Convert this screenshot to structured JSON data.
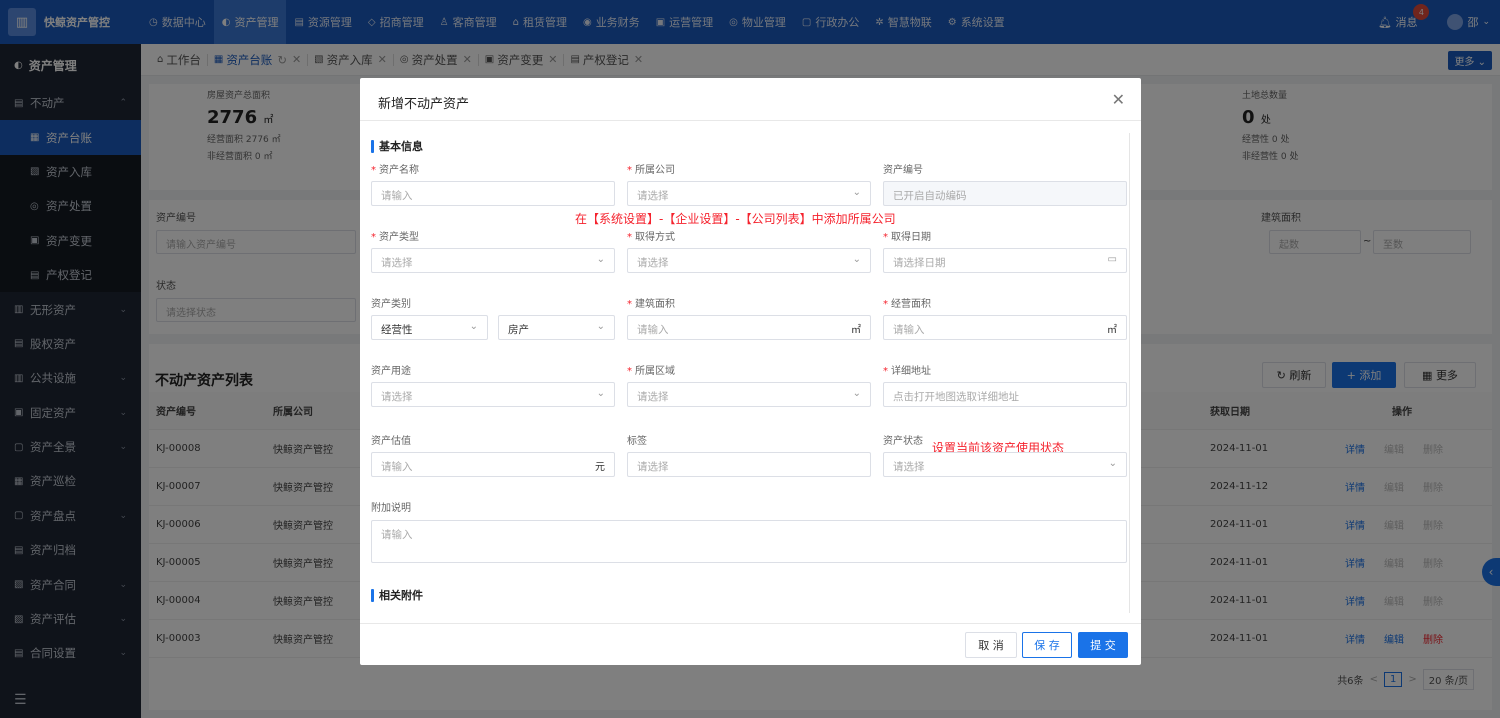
{
  "app": {
    "logo_text": "快鲸资产管控"
  },
  "topnav": [
    {
      "icon": "◷",
      "label": "数据中心"
    },
    {
      "icon": "◐",
      "label": "资产管理",
      "active": true
    },
    {
      "icon": "▤",
      "label": "资源管理"
    },
    {
      "icon": "◇",
      "label": "招商管理"
    },
    {
      "icon": "♙",
      "label": "客商管理"
    },
    {
      "icon": "⌂",
      "label": "租赁管理"
    },
    {
      "icon": "◉",
      "label": "业务财务"
    },
    {
      "icon": "▣",
      "label": "运营管理"
    },
    {
      "icon": "◎",
      "label": "物业管理"
    },
    {
      "icon": "▢",
      "label": "行政办公"
    },
    {
      "icon": "✲",
      "label": "智慧物联"
    },
    {
      "icon": "⚙",
      "label": "系统设置"
    }
  ],
  "header_right": {
    "message_label": "消息",
    "badge": "4",
    "user": "邵"
  },
  "sidebar": {
    "title": "资产管理",
    "items": [
      {
        "label": "不动产",
        "icon": "▤",
        "arrow": "⌃"
      },
      {
        "label": "资产台账",
        "sub": true,
        "active": true,
        "icon": "▦"
      },
      {
        "label": "资产入库",
        "sub": true,
        "icon": "▧"
      },
      {
        "label": "资产处置",
        "sub": true,
        "icon": "◎"
      },
      {
        "label": "资产变更",
        "sub": true,
        "icon": "▣"
      },
      {
        "label": "产权登记",
        "sub": true,
        "icon": "▤"
      },
      {
        "label": "无形资产",
        "icon": "▥",
        "arrow": "⌄"
      },
      {
        "label": "股权资产",
        "icon": "▤"
      },
      {
        "label": "公共设施",
        "icon": "▥",
        "arrow": "⌄"
      },
      {
        "label": "固定资产",
        "icon": "▣",
        "arrow": "⌄"
      },
      {
        "label": "资产全景",
        "icon": "▢",
        "arrow": "⌄"
      },
      {
        "label": "资产巡检",
        "icon": "▦"
      },
      {
        "label": "资产盘点",
        "icon": "▢",
        "arrow": "⌄"
      },
      {
        "label": "资产归档",
        "icon": "▤"
      },
      {
        "label": "资产合同",
        "icon": "▧",
        "arrow": "⌄"
      },
      {
        "label": "资产评估",
        "icon": "▨",
        "arrow": "⌄"
      },
      {
        "label": "合同设置",
        "icon": "▤",
        "arrow": "⌄"
      }
    ],
    "collapse_icon": "☰"
  },
  "tabs": [
    {
      "label": "工作台",
      "icon": "⌂",
      "closable": false
    },
    {
      "label": "资产台账",
      "icon": "▦",
      "active": true,
      "closable": true,
      "refresh": "↻"
    },
    {
      "label": "资产入库",
      "icon": "▧",
      "closable": true
    },
    {
      "label": "资产处置",
      "icon": "◎",
      "closable": true
    },
    {
      "label": "资产变更",
      "icon": "▣",
      "closable": true
    },
    {
      "label": "产权登记",
      "icon": "▤",
      "closable": true
    }
  ],
  "tabs_more": "更多 ⌄",
  "kpi_left": {
    "label": "房屋资产总面积",
    "value": "2776",
    "unit": "㎡",
    "sub1": "经营面积 2776 ㎡",
    "sub2": "非经营面积 0 ㎡"
  },
  "kpi_right": {
    "label": "土地总数量",
    "value": "0",
    "unit": "处",
    "sub1": "经营性 0 处",
    "sub2": "非经营性 0 处"
  },
  "filters": {
    "asset_no_label": "资产编号",
    "asset_no_ph": "请输入资产编号",
    "status_label": "状态",
    "status_ph": "请选择状态",
    "area_label": "建筑面积",
    "area_from": "起数",
    "area_sep": "~",
    "area_to": "至数"
  },
  "list": {
    "title": "不动产资产列表",
    "refresh": "刷新",
    "add": "+ 添加",
    "more": "更多",
    "col_no": "资产编号",
    "col_company": "所属公司",
    "col_date": "获取日期",
    "col_ops": "操作",
    "rows": [
      {
        "no": "KJ-00008",
        "company": "快鲸资产管控",
        "date": "2024-11-01"
      },
      {
        "no": "KJ-00007",
        "company": "快鲸资产管控",
        "date": "2024-11-12"
      },
      {
        "no": "KJ-00006",
        "company": "快鲸资产管控",
        "date": "2024-11-01"
      },
      {
        "no": "KJ-00005",
        "company": "快鲸资产管控",
        "date": "2024-11-01"
      },
      {
        "no": "KJ-00004",
        "company": "快鲸资产管控",
        "date": "2024-11-01"
      },
      {
        "no": "KJ-00003",
        "company": "快鲸资产管控",
        "date": "2024-11-01"
      }
    ],
    "op_detail": "详情",
    "op_edit": "编辑",
    "op_delete": "删除",
    "total": "共6条",
    "page": "1",
    "page_size": "20 条/页"
  },
  "modal": {
    "title": "新增不动产资产",
    "section_basic": "基本信息",
    "section_attach": "相关附件",
    "fields": {
      "name_label": "资产名称",
      "name_ph": "请输入",
      "company_label": "所属公司",
      "company_ph": "请选择",
      "code_label": "资产编号",
      "code_ph": "已开启自动编码",
      "type_label": "资产类型",
      "type_ph": "请选择",
      "acquire_label": "取得方式",
      "acquire_ph": "请选择",
      "date_label": "取得日期",
      "date_ph": "请选择日期",
      "category_label": "资产类别",
      "category_v1": "经营性",
      "category_v2": "房产",
      "build_area_label": "建筑面积",
      "build_area_ph": "请输入",
      "area_unit": "㎡",
      "op_area_label": "经营面积",
      "op_area_ph": "请输入",
      "usage_label": "资产用途",
      "usage_ph": "请选择",
      "region_label": "所属区域",
      "region_ph": "请选择",
      "address_label": "详细地址",
      "address_ph": "点击打开地图选取详细地址",
      "value_label": "资产估值",
      "value_ph": "请输入",
      "value_unit": "元",
      "tag_label": "标签",
      "tag_ph": "请选择",
      "status_label": "资产状态",
      "status_ph": "请选择",
      "note_label": "附加说明",
      "note_ph": "请输入"
    },
    "annotation_company": "在【系统设置】-【企业设置】-【公司列表】中添加所属公司",
    "annotation_status": "设置当前该资产使用状态",
    "cancel": "取 消",
    "save": "保 存",
    "submit": "提 交"
  },
  "colors": {
    "primary": "#1a5bbf",
    "accent": "#1a73e8",
    "danger": "#f5222d",
    "sidebar": "#1f2734"
  }
}
